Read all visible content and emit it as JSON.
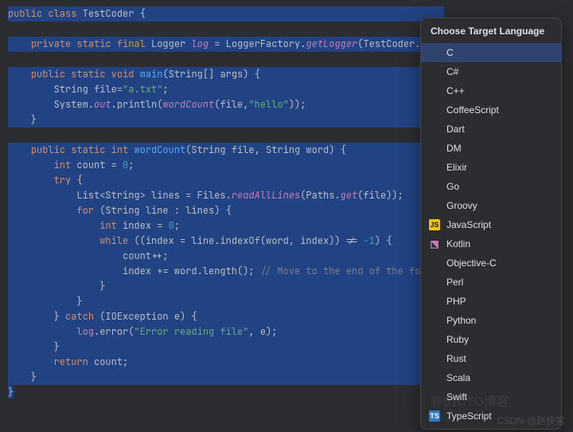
{
  "editor": {
    "tokens": [
      [
        "kw",
        "public"
      ],
      [
        "",
        " "
      ],
      [
        "kw",
        "class"
      ],
      [
        "",
        " "
      ],
      [
        "cls",
        "TestCoder"
      ],
      [
        "",
        " {"
      ],
      [
        "nl",
        ""
      ],
      [
        "nl",
        ""
      ],
      [
        "",
        "    "
      ],
      [
        "kw",
        "private static final"
      ],
      [
        "",
        " Logger "
      ],
      [
        "fi",
        "log"
      ],
      [
        "",
        " = LoggerFactory."
      ],
      [
        "fi",
        "getLogger"
      ],
      [
        "",
        "(TestCoder."
      ],
      [
        "nl",
        ""
      ],
      [
        "nl",
        ""
      ],
      [
        "",
        "    "
      ],
      [
        "kw",
        "public static void"
      ],
      [
        "",
        " "
      ],
      [
        "fn",
        "main"
      ],
      [
        "",
        "(String[] args) {"
      ],
      [
        "nl",
        ""
      ],
      [
        "",
        "        String file="
      ],
      [
        "str",
        "\"a.txt\""
      ],
      [
        "",
        ";"
      ],
      [
        "nl",
        ""
      ],
      [
        "",
        "        System."
      ],
      [
        "fi",
        "out"
      ],
      [
        "",
        ".println("
      ],
      [
        "fi",
        "wordCount"
      ],
      [
        "",
        "(file,"
      ],
      [
        "str",
        "\"hello\""
      ],
      [
        "",
        "));"
      ],
      [
        "nl",
        ""
      ],
      [
        "",
        "    }"
      ],
      [
        "nl",
        ""
      ],
      [
        "nl",
        ""
      ],
      [
        "",
        "    "
      ],
      [
        "kw",
        "public static int"
      ],
      [
        "",
        " "
      ],
      [
        "fn",
        "wordCount"
      ],
      [
        "",
        "(String file, String word) {"
      ],
      [
        "nl",
        ""
      ],
      [
        "",
        "        "
      ],
      [
        "kw",
        "int"
      ],
      [
        "",
        " count = "
      ],
      [
        "num",
        "0"
      ],
      [
        "",
        ";"
      ],
      [
        "nl",
        ""
      ],
      [
        "",
        "        "
      ],
      [
        "kw",
        "try"
      ],
      [
        "",
        " {"
      ],
      [
        "nl",
        ""
      ],
      [
        "",
        "            List<String> lines = Files."
      ],
      [
        "fi",
        "readAllLines"
      ],
      [
        "",
        "(Paths."
      ],
      [
        "fi",
        "get"
      ],
      [
        "",
        "(file));"
      ],
      [
        "nl",
        ""
      ],
      [
        "",
        "            "
      ],
      [
        "kw",
        "for"
      ],
      [
        "",
        " (String line : lines) {"
      ],
      [
        "nl",
        ""
      ],
      [
        "",
        "                "
      ],
      [
        "kw",
        "int"
      ],
      [
        "",
        " index = "
      ],
      [
        "num",
        "0"
      ],
      [
        "",
        ";"
      ],
      [
        "nl",
        ""
      ],
      [
        "",
        "                "
      ],
      [
        "kw",
        "while"
      ],
      [
        "",
        " ((index = line.indexOf(word, index)) != "
      ],
      [
        "num",
        "-1"
      ],
      [
        "",
        ") {"
      ],
      [
        "nl",
        ""
      ],
      [
        "",
        "                    count++;"
      ],
      [
        "nl",
        ""
      ],
      [
        "",
        "                    index += word.length(); "
      ],
      [
        "cmt",
        "// Move to the end of the fou"
      ],
      [
        "nl",
        ""
      ],
      [
        "",
        "                }"
      ],
      [
        "nl",
        ""
      ],
      [
        "",
        "            }"
      ],
      [
        "nl",
        ""
      ],
      [
        "",
        "        } "
      ],
      [
        "kw",
        "catch"
      ],
      [
        "",
        " (IOException e) {"
      ],
      [
        "nl",
        ""
      ],
      [
        "",
        "            "
      ],
      [
        "field",
        "log"
      ],
      [
        "",
        ".error("
      ],
      [
        "str",
        "\"Error reading file\""
      ],
      [
        "",
        ", e);"
      ],
      [
        "nl",
        ""
      ],
      [
        "",
        "        }"
      ],
      [
        "nl",
        ""
      ],
      [
        "",
        "        "
      ],
      [
        "kw",
        "return"
      ],
      [
        "",
        " count;"
      ],
      [
        "nl",
        ""
      ],
      [
        "",
        "    }"
      ],
      [
        "nl",
        ""
      ]
    ],
    "closingBrace": "}"
  },
  "popup": {
    "title": "Choose Target Language",
    "items": [
      {
        "label": "C",
        "selected": true,
        "icon": null
      },
      {
        "label": "C#",
        "selected": false,
        "icon": null
      },
      {
        "label": "C++",
        "selected": false,
        "icon": null
      },
      {
        "label": "CoffeeScript",
        "selected": false,
        "icon": null
      },
      {
        "label": "Dart",
        "selected": false,
        "icon": null
      },
      {
        "label": "DM",
        "selected": false,
        "icon": null
      },
      {
        "label": "Elixir",
        "selected": false,
        "icon": null
      },
      {
        "label": "Go",
        "selected": false,
        "icon": null
      },
      {
        "label": "Groovy",
        "selected": false,
        "icon": null
      },
      {
        "label": "JavaScript",
        "selected": false,
        "icon": "js"
      },
      {
        "label": "Kotlin",
        "selected": false,
        "icon": "kt"
      },
      {
        "label": "Objective-C",
        "selected": false,
        "icon": null
      },
      {
        "label": "Perl",
        "selected": false,
        "icon": null
      },
      {
        "label": "PHP",
        "selected": false,
        "icon": null
      },
      {
        "label": "Python",
        "selected": false,
        "icon": null
      },
      {
        "label": "Ruby",
        "selected": false,
        "icon": null
      },
      {
        "label": "Rust",
        "selected": false,
        "icon": null
      },
      {
        "label": "Scala",
        "selected": false,
        "icon": null
      },
      {
        "label": "Swift",
        "selected": false,
        "icon": null
      },
      {
        "label": "TypeScript",
        "selected": false,
        "icon": "ts"
      }
    ]
  },
  "watermark": "CSDN @赵侠客",
  "watermark2": "@51CTO博客"
}
